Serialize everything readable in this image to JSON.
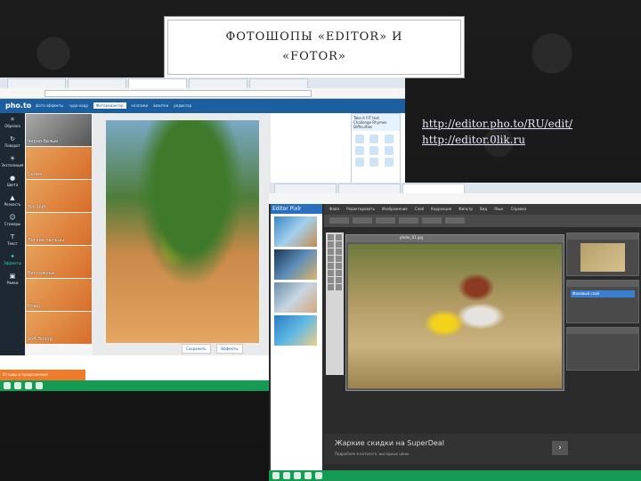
{
  "slide": {
    "title": "ФОТОШОПЫ «EDITOR» И «FOTOR»",
    "links": [
      "http://editor.pho.to/RU/edit/",
      "http://editor.0lik.ru"
    ]
  },
  "editor1": {
    "logo": "pho.to",
    "menu": [
      "фото эффекты",
      "чудо-кадр",
      "Фоторедактор",
      "коллажи",
      "визитки",
      "редактор"
    ],
    "active_menu": "Фоторедактор",
    "sidebar": [
      "Обрезка",
      "Поворот",
      "Экспозиция",
      "Цвета",
      "Резкость",
      "Стикеры",
      "Текст",
      "Эффекты",
      "Рамки"
    ],
    "filters": [
      "Черно-белые",
      "Сепия",
      "Tilt-Shift",
      "Легкие пыльцы",
      "Винтажные",
      "Блюр",
      "Soft Toning"
    ],
    "footer_buttons": [
      "Сохранить",
      "Эффекты"
    ],
    "status": "Отзывы и предложения",
    "ad_head": "Take it FIT test Challenge Rhymes Difficulties"
  },
  "editor2": {
    "logo": "Editor Pixlr",
    "ad_text": "Жаркие скидки на SuperDeal",
    "ad_sub": "Подробнее в каталоге, выгодные цены",
    "ad_button": "›",
    "canvas_title": "photo_01.jpg",
    "layer": "Фоновый слой",
    "menu": [
      "Файл",
      "Редактировать",
      "Изображение",
      "Слой",
      "Коррекция",
      "Фильтр",
      "Вид",
      "Язык",
      "Справка"
    ]
  }
}
